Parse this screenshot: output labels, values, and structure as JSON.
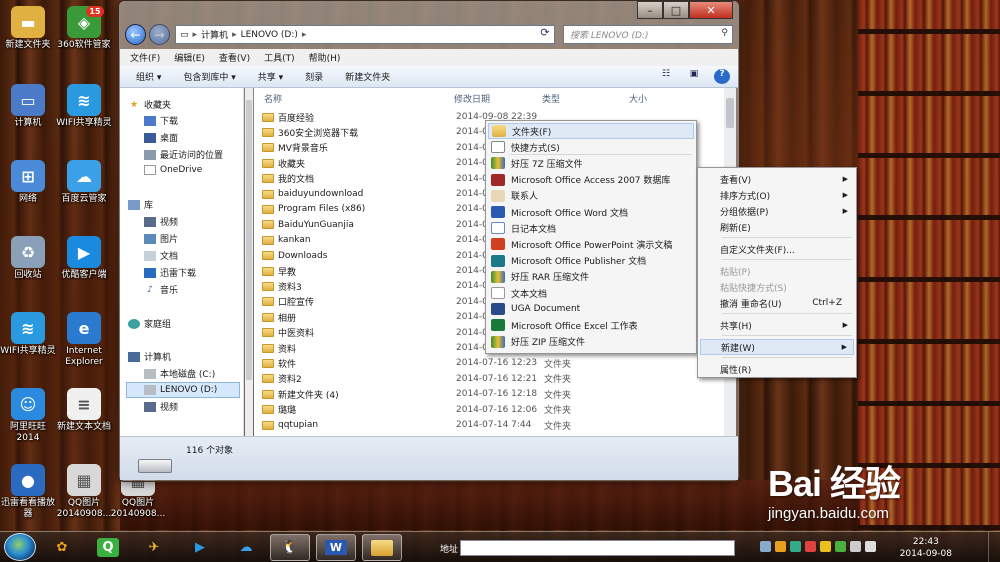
{
  "desktop_icons": [
    {
      "label": "新建文件夹",
      "icon": "folder-icon",
      "color": "#e0b040"
    },
    {
      "label": "360软件管家",
      "icon": "360-icon",
      "color": "#3a9a3a",
      "badge": "15"
    },
    {
      "label": "计算机",
      "icon": "computer-icon",
      "color": "#4a7ac8"
    },
    {
      "label": "WIFI共享精灵",
      "icon": "wifi-icon",
      "color": "#2a9ae0"
    },
    {
      "label": "网络",
      "icon": "network-icon",
      "color": "#4a8ad8"
    },
    {
      "label": "百度云管家",
      "icon": "cloud-icon",
      "color": "#3aa0e8"
    },
    {
      "label": "回收站",
      "icon": "recycle-bin-icon",
      "color": "#8aa0b8"
    },
    {
      "label": "优酷客户端",
      "icon": "youku-icon",
      "color": "#1a8ae0"
    },
    {
      "label": "WIFI共享精灵",
      "icon": "wifi-icon",
      "color": "#2a9ae0"
    },
    {
      "label": "Internet Explorer",
      "icon": "ie-icon",
      "color": "#2a7ad0"
    },
    {
      "label": "阿里旺旺2014",
      "icon": "aliwangwang-icon",
      "color": "#2a8ae0"
    },
    {
      "label": "新建文本文档",
      "icon": "text-document-icon",
      "color": "#f0f0f0"
    },
    {
      "label": "迅雷看看播放器",
      "icon": "xunlei-player-icon",
      "color": "#2a6ac0"
    },
    {
      "label": "QQ图片20140908...",
      "icon": "image-icon",
      "color": "#d8d8d8"
    },
    {
      "label": "QQ图片20140908...",
      "icon": "image-icon",
      "color": "#d8d8d8"
    }
  ],
  "explorer": {
    "breadcrumb": [
      "计算机",
      "LENOVO (D:)"
    ],
    "search_placeholder": "搜索 LENOVO (D:)",
    "menu": [
      "文件(F)",
      "编辑(E)",
      "查看(V)",
      "工具(T)",
      "帮助(H)"
    ],
    "toolbar": [
      "组织 ▾",
      "包含到库中 ▾",
      "共享 ▾",
      "刻录",
      "新建文件夹"
    ],
    "nav": {
      "favorites": "收藏夹",
      "favorites_items": [
        "下载",
        "桌面",
        "最近访问的位置",
        "OneDrive"
      ],
      "libraries": "库",
      "libraries_items": [
        "视频",
        "图片",
        "文档",
        "迅雷下载",
        "音乐"
      ],
      "homegroup": "家庭组",
      "computer": "计算机",
      "computer_items": [
        "本地磁盘 (C:)",
        "LENOVO (D:)",
        "视频"
      ]
    },
    "columns": {
      "name": "名称",
      "date": "修改日期",
      "type": "类型",
      "size": "大小"
    },
    "files": [
      {
        "name": "百度经验",
        "date": "2014-09-08 22:39",
        "type": ""
      },
      {
        "name": "360安全浏览器下载",
        "date": "2014-0",
        "type": ""
      },
      {
        "name": "MV背景音乐",
        "date": "2014-0",
        "type": ""
      },
      {
        "name": "收藏夹",
        "date": "2014-0",
        "type": ""
      },
      {
        "name": "我的文档",
        "date": "2014-0",
        "type": ""
      },
      {
        "name": "baiduyundownload",
        "date": "2014-0",
        "type": ""
      },
      {
        "name": "Program Files (x86)",
        "date": "2014-0",
        "type": ""
      },
      {
        "name": "BaiduYunGuanjia",
        "date": "2014-0",
        "type": ""
      },
      {
        "name": "kankan",
        "date": "2014-0",
        "type": ""
      },
      {
        "name": "Downloads",
        "date": "2014-0",
        "type": ""
      },
      {
        "name": "早教",
        "date": "2014-0",
        "type": ""
      },
      {
        "name": "资料3",
        "date": "2014-0",
        "type": ""
      },
      {
        "name": "口腔宣传",
        "date": "2014-0",
        "type": ""
      },
      {
        "name": "相册",
        "date": "2014-0",
        "type": ""
      },
      {
        "name": "中医资料",
        "date": "2014-0",
        "type": ""
      },
      {
        "name": "资料",
        "date": "2014-0",
        "type": ""
      },
      {
        "name": "软件",
        "date": "2014-07-16 12:23",
        "type": "文件夹"
      },
      {
        "name": "资料2",
        "date": "2014-07-16 12:21",
        "type": "文件夹"
      },
      {
        "name": "新建文件夹 (4)",
        "date": "2014-07-16 12:18",
        "type": "文件夹"
      },
      {
        "name": "璐璐",
        "date": "2014-07-16 12:06",
        "type": "文件夹"
      },
      {
        "name": "qqtupian",
        "date": "2014-07-14 7:44",
        "type": "文件夹"
      }
    ],
    "status_count": "116 个对象"
  },
  "context_menu": {
    "items": [
      {
        "label": "查看(V)",
        "submenu": true,
        "disabled": false
      },
      {
        "label": "排序方式(O)",
        "submenu": true,
        "disabled": false
      },
      {
        "label": "分组依据(P)",
        "submenu": true,
        "disabled": false
      },
      {
        "label": "刷新(E)",
        "submenu": false,
        "disabled": false
      },
      {
        "label": "自定义文件夹(F)...",
        "submenu": false,
        "disabled": false
      },
      {
        "label": "粘贴(P)",
        "submenu": false,
        "disabled": true
      },
      {
        "label": "粘贴快捷方式(S)",
        "submenu": false,
        "disabled": true
      },
      {
        "label": "撤消 重命名(U)",
        "submenu": false,
        "disabled": false,
        "shortcut": "Ctrl+Z"
      },
      {
        "label": "共享(H)",
        "submenu": true,
        "disabled": false
      },
      {
        "label": "新建(W)",
        "submenu": true,
        "disabled": false,
        "highlighted": true
      },
      {
        "label": "属性(R)",
        "submenu": false,
        "disabled": false
      }
    ]
  },
  "new_submenu": {
    "items": [
      {
        "label": "文件夹(F)",
        "icon": "folder-icon",
        "highlighted": true
      },
      {
        "label": "快捷方式(S)",
        "icon": "shortcut-icon"
      },
      {
        "label": "好压 7Z 压缩文件",
        "icon": "archive-icon"
      },
      {
        "label": "Microsoft Office Access 2007 数据库",
        "icon": "access-icon"
      },
      {
        "label": "联系人",
        "icon": "contact-icon"
      },
      {
        "label": "Microsoft Office Word 文档",
        "icon": "word-icon"
      },
      {
        "label": "日记本文档",
        "icon": "journal-icon"
      },
      {
        "label": "Microsoft Office PowerPoint 演示文稿",
        "icon": "powerpoint-icon"
      },
      {
        "label": "Microsoft Office Publisher 文档",
        "icon": "publisher-icon"
      },
      {
        "label": "好压 RAR 压缩文件",
        "icon": "archive-icon"
      },
      {
        "label": "文本文档",
        "icon": "text-document-icon"
      },
      {
        "label": "UGA Document",
        "icon": "uga-icon"
      },
      {
        "label": "Microsoft Office Excel 工作表",
        "icon": "excel-icon"
      },
      {
        "label": "好压 ZIP 压缩文件",
        "icon": "archive-icon"
      }
    ]
  },
  "taskbar": {
    "address_label": "地址",
    "time": "22:43",
    "date": "2014-09-08"
  },
  "watermark": {
    "logo": "Bai 经验",
    "url": "jingyan.baidu.com"
  },
  "colors": {
    "accent": "#2a6ac8",
    "folder": "#e0b040",
    "menu_highlight": "#dfe9f6"
  }
}
